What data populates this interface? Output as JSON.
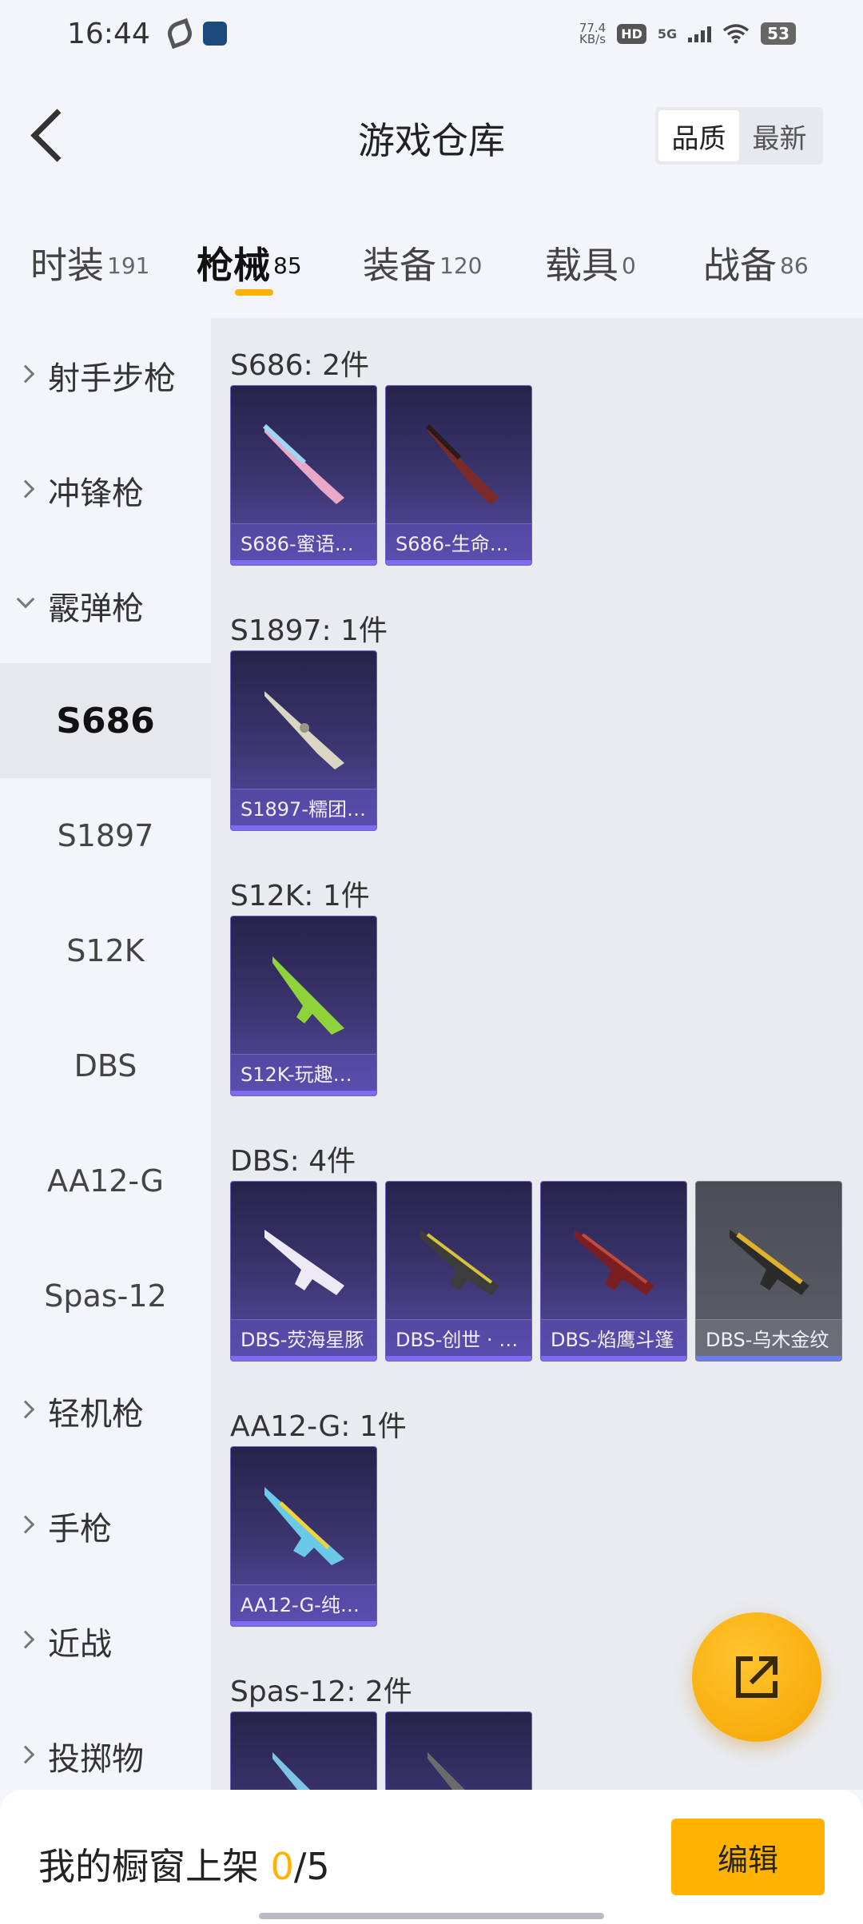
{
  "status_bar": {
    "time": "16:44",
    "net_speed_value": "77.4",
    "net_speed_unit": "KB/s",
    "hd": "HD",
    "network": "5G",
    "battery": "53"
  },
  "header": {
    "title": "游戏仓库",
    "sort_quality": "品质",
    "sort_newest": "最新"
  },
  "tabs": [
    {
      "label": "时装",
      "count": "191"
    },
    {
      "label": "枪械",
      "count": "85"
    },
    {
      "label": "装备",
      "count": "120"
    },
    {
      "label": "载具",
      "count": "0"
    },
    {
      "label": "战备",
      "count": "86"
    }
  ],
  "sidebar": [
    "射手步枪",
    "冲锋枪",
    "霰弹枪",
    "S686",
    "S1897",
    "S12K",
    "DBS",
    "AA12-G",
    "Spas-12",
    "轻机枪",
    "手枪",
    "近战",
    "投掷物"
  ],
  "groups": [
    {
      "title": "S686: 2件",
      "items": [
        "S686-蜜语…",
        "S686-生命…"
      ]
    },
    {
      "title": "S1897: 1件",
      "items": [
        "S1897-糯团…"
      ]
    },
    {
      "title": "S12K: 1件",
      "items": [
        "S12K-玩趣…"
      ]
    },
    {
      "title": "DBS: 4件",
      "items": [
        "DBS-荧海星豚",
        "DBS-创世 · …",
        "DBS-焰鹰斗篷",
        "DBS-乌木金纹"
      ]
    },
    {
      "title": "AA12-G: 1件",
      "items": [
        "AA12-G-纯…"
      ]
    },
    {
      "title": "Spas-12: 2件",
      "items": []
    }
  ],
  "bottom_bar": {
    "label": "我的橱窗上架",
    "count_current": "0",
    "count_total": "/5",
    "edit_button": "编辑"
  },
  "colors": {
    "accent": "#ffb300",
    "card_purple": "#3d3672",
    "card_grey": "#5c5e68"
  }
}
